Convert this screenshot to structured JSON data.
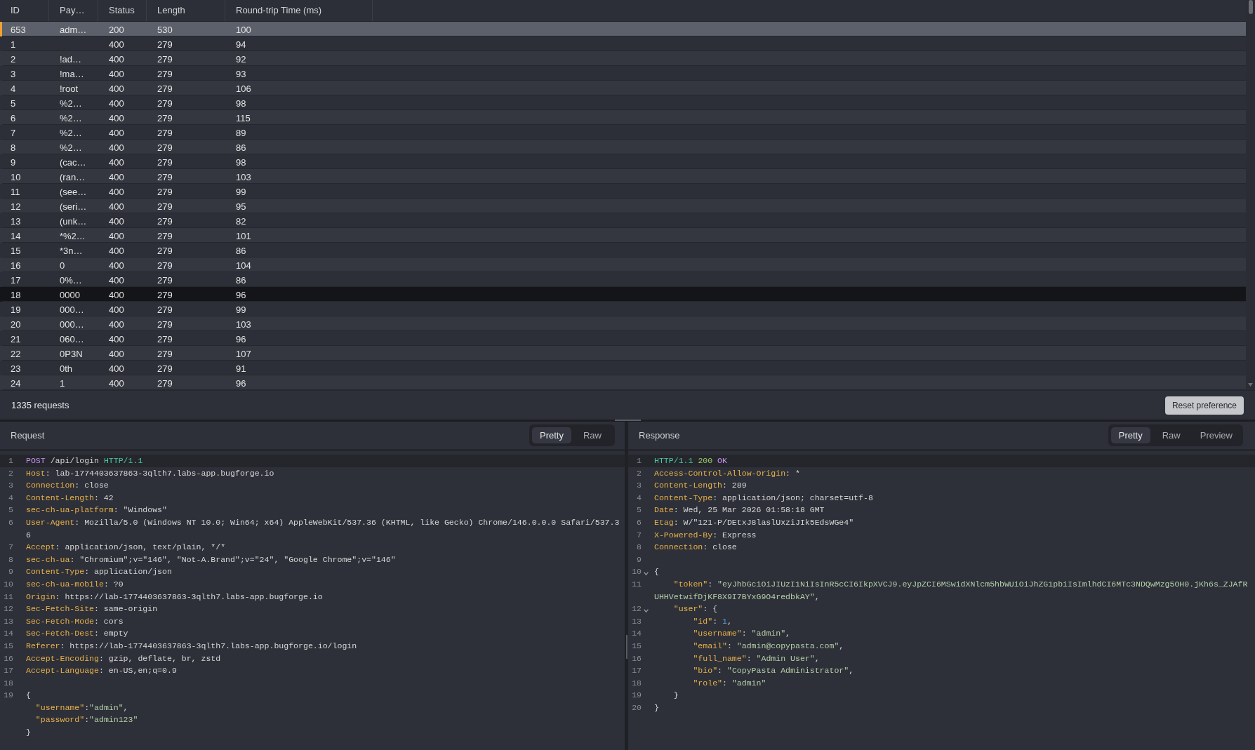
{
  "table": {
    "columns": [
      "ID",
      "Pay…",
      "Status",
      "Length",
      "Round-trip Time (ms)"
    ],
    "rows": [
      {
        "id": "653",
        "payload": "adm…",
        "status": "200",
        "length": "530",
        "round_trip_time": "100",
        "selected": true,
        "hovered": false
      },
      {
        "id": "1",
        "status": "400",
        "length": "279",
        "round_trip_time": "94",
        "selected": false,
        "hovered": false
      },
      {
        "id": "2",
        "payload": "!ad…",
        "status": "400",
        "length": "279",
        "round_trip_time": "92",
        "selected": false,
        "hovered": false
      },
      {
        "id": "3",
        "payload": "!ma…",
        "status": "400",
        "length": "279",
        "round_trip_time": "93",
        "selected": false,
        "hovered": false
      },
      {
        "id": "4",
        "payload": "!root",
        "status": "400",
        "length": "279",
        "round_trip_time": "106",
        "selected": false,
        "hovered": false
      },
      {
        "id": "5",
        "payload": "%2…",
        "status": "400",
        "length": "279",
        "round_trip_time": "98",
        "selected": false,
        "hovered": false
      },
      {
        "id": "6",
        "payload": "%2…",
        "status": "400",
        "length": "279",
        "round_trip_time": "115",
        "selected": false,
        "hovered": false
      },
      {
        "id": "7",
        "payload": "%2…",
        "status": "400",
        "length": "279",
        "round_trip_time": "89",
        "selected": false,
        "hovered": false
      },
      {
        "id": "8",
        "payload": "%2…",
        "status": "400",
        "length": "279",
        "round_trip_time": "86",
        "selected": false,
        "hovered": false
      },
      {
        "id": "9",
        "payload": "(cac…",
        "status": "400",
        "length": "279",
        "round_trip_time": "98",
        "selected": false,
        "hovered": false
      },
      {
        "id": "10",
        "payload": "(ran…",
        "status": "400",
        "length": "279",
        "round_trip_time": "103",
        "selected": false,
        "hovered": false
      },
      {
        "id": "11",
        "payload": "(see…",
        "status": "400",
        "length": "279",
        "round_trip_time": "99",
        "selected": false,
        "hovered": false
      },
      {
        "id": "12",
        "payload": "(seri…",
        "status": "400",
        "length": "279",
        "round_trip_time": "95",
        "selected": false,
        "hovered": false
      },
      {
        "id": "13",
        "payload": "(unk…",
        "status": "400",
        "length": "279",
        "round_trip_time": "82",
        "selected": false,
        "hovered": false
      },
      {
        "id": "14",
        "payload": "*%2…",
        "status": "400",
        "length": "279",
        "round_trip_time": "101",
        "selected": false,
        "hovered": false
      },
      {
        "id": "15",
        "payload": "*3n…",
        "status": "400",
        "length": "279",
        "round_trip_time": "86",
        "selected": false,
        "hovered": false
      },
      {
        "id": "16",
        "payload": "0",
        "status": "400",
        "length": "279",
        "round_trip_time": "104",
        "selected": false,
        "hovered": false
      },
      {
        "id": "17",
        "payload": "0%…",
        "status": "400",
        "length": "279",
        "round_trip_time": "86",
        "selected": false,
        "hovered": false
      },
      {
        "id": "18",
        "payload": "0000",
        "status": "400",
        "length": "279",
        "round_trip_time": "96",
        "selected": false,
        "hovered": true
      },
      {
        "id": "19",
        "payload": "000…",
        "status": "400",
        "length": "279",
        "round_trip_time": "99",
        "selected": false,
        "hovered": false
      },
      {
        "id": "20",
        "payload": "000…",
        "status": "400",
        "length": "279",
        "round_trip_time": "103",
        "selected": false,
        "hovered": false
      },
      {
        "id": "21",
        "payload": "060…",
        "status": "400",
        "length": "279",
        "round_trip_time": "96",
        "selected": false,
        "hovered": false
      },
      {
        "id": "22",
        "payload": "0P3N",
        "status": "400",
        "length": "279",
        "round_trip_time": "107",
        "selected": false,
        "hovered": false
      },
      {
        "id": "23",
        "payload": "0th",
        "status": "400",
        "length": "279",
        "round_trip_time": "91",
        "selected": false,
        "hovered": false
      },
      {
        "id": "24",
        "payload": "1",
        "status": "400",
        "length": "279",
        "round_trip_time": "96",
        "selected": false,
        "hovered": false
      }
    ]
  },
  "status_bar": {
    "request_count": "1335 requests",
    "reset_button": "Reset preference"
  },
  "request": {
    "title": "Request",
    "tabs": [
      {
        "label": "Pretty",
        "selected": true
      },
      {
        "label": "Raw",
        "selected": false
      }
    ],
    "lines": [
      {
        "number": "1",
        "active": true,
        "tokens": [
          {
            "kind": "method",
            "text": "POST"
          },
          {
            "kind": "plain",
            "text": " /api/login "
          },
          {
            "kind": "protocol",
            "text": "HTTP/1.1"
          }
        ]
      },
      {
        "number": "2",
        "active": false,
        "tokens": [
          {
            "kind": "key",
            "text": "Host"
          },
          {
            "kind": "plain",
            "text": ": lab-1774403637863-3qlth7.labs-app.bugforge.io"
          }
        ]
      },
      {
        "number": "3",
        "active": false,
        "tokens": [
          {
            "kind": "key",
            "text": "Connection"
          },
          {
            "kind": "plain",
            "text": ": close"
          }
        ]
      },
      {
        "number": "4",
        "active": false,
        "tokens": [
          {
            "kind": "key",
            "text": "Content-Length"
          },
          {
            "kind": "plain",
            "text": ": 42"
          }
        ]
      },
      {
        "number": "5",
        "active": false,
        "tokens": [
          {
            "kind": "key",
            "text": "sec-ch-ua-platform"
          },
          {
            "kind": "plain",
            "text": ": \"Windows\""
          }
        ]
      },
      {
        "number": "6",
        "active": false,
        "tokens": [
          {
            "kind": "key",
            "text": "User-Agent"
          },
          {
            "kind": "plain",
            "text": ": Mozilla/5.0 (Windows NT 10.0; Win64; x64) AppleWebKit/537.36 (KHTML, like Gecko) Chrome/146.0.0.0 Safari/537.36"
          }
        ]
      },
      {
        "number": "7",
        "active": false,
        "tokens": [
          {
            "kind": "key",
            "text": "Accept"
          },
          {
            "kind": "plain",
            "text": ": application/json, text/plain, */*"
          }
        ]
      },
      {
        "number": "8",
        "active": false,
        "tokens": [
          {
            "kind": "key",
            "text": "sec-ch-ua"
          },
          {
            "kind": "plain",
            "text": ": \"Chromium\";v=\"146\", \"Not-A.Brand\";v=\"24\", \"Google Chrome\";v=\"146\""
          }
        ]
      },
      {
        "number": "9",
        "active": false,
        "tokens": [
          {
            "kind": "key",
            "text": "Content-Type"
          },
          {
            "kind": "plain",
            "text": ": application/json"
          }
        ]
      },
      {
        "number": "10",
        "active": false,
        "tokens": [
          {
            "kind": "key",
            "text": "sec-ch-ua-mobile"
          },
          {
            "kind": "plain",
            "text": ": ?0"
          }
        ]
      },
      {
        "number": "11",
        "active": false,
        "tokens": [
          {
            "kind": "key",
            "text": "Origin"
          },
          {
            "kind": "plain",
            "text": ": https://lab-1774403637863-3qlth7.labs-app.bugforge.io"
          }
        ]
      },
      {
        "number": "12",
        "active": false,
        "tokens": [
          {
            "kind": "key",
            "text": "Sec-Fetch-Site"
          },
          {
            "kind": "plain",
            "text": ": same-origin"
          }
        ]
      },
      {
        "number": "13",
        "active": false,
        "tokens": [
          {
            "kind": "key",
            "text": "Sec-Fetch-Mode"
          },
          {
            "kind": "plain",
            "text": ": cors"
          }
        ]
      },
      {
        "number": "14",
        "active": false,
        "tokens": [
          {
            "kind": "key",
            "text": "Sec-Fetch-Dest"
          },
          {
            "kind": "plain",
            "text": ": empty"
          }
        ]
      },
      {
        "number": "15",
        "active": false,
        "tokens": [
          {
            "kind": "key",
            "text": "Referer"
          },
          {
            "kind": "plain",
            "text": ": https://lab-1774403637863-3qlth7.labs-app.bugforge.io/login"
          }
        ]
      },
      {
        "number": "16",
        "active": false,
        "tokens": [
          {
            "kind": "key",
            "text": "Accept-Encoding"
          },
          {
            "kind": "plain",
            "text": ": gzip, deflate, br, zstd"
          }
        ]
      },
      {
        "number": "17",
        "active": false,
        "tokens": [
          {
            "kind": "key",
            "text": "Accept-Language"
          },
          {
            "kind": "plain",
            "text": ": en-US,en;q=0.9"
          }
        ]
      },
      {
        "number": "18",
        "active": false
      },
      {
        "number": "19",
        "active": false,
        "tokens": [
          {
            "kind": "plain",
            "text": "{"
          }
        ]
      },
      {
        "active": false,
        "tokens": [
          {
            "kind": "key",
            "text": "  \"username\""
          },
          {
            "kind": "plain",
            "text": ":"
          },
          {
            "kind": "string",
            "text": "\"admin\""
          },
          {
            "kind": "plain",
            "text": ","
          }
        ]
      },
      {
        "active": false,
        "tokens": [
          {
            "kind": "key",
            "text": "  \"password\""
          },
          {
            "kind": "plain",
            "text": ":"
          },
          {
            "kind": "string",
            "text": "\"admin123\""
          }
        ]
      },
      {
        "active": false,
        "tokens": [
          {
            "kind": "plain",
            "text": "}"
          }
        ]
      }
    ]
  },
  "response": {
    "title": "Response",
    "tabs": [
      {
        "label": "Pretty",
        "selected": true
      },
      {
        "label": "Raw",
        "selected": false
      },
      {
        "label": "Preview",
        "selected": false
      }
    ],
    "lines": [
      {
        "number": "1",
        "active": true,
        "tokens": [
          {
            "kind": "protocol",
            "text": "HTTP/1.1 "
          },
          {
            "kind": "status",
            "text": "200 "
          },
          {
            "kind": "reason",
            "text": "OK"
          }
        ]
      },
      {
        "number": "2",
        "active": false,
        "tokens": [
          {
            "kind": "key",
            "text": "Access-Control-Allow-Origin"
          },
          {
            "kind": "plain",
            "text": ": *"
          }
        ]
      },
      {
        "number": "3",
        "active": false,
        "tokens": [
          {
            "kind": "key",
            "text": "Content-Length"
          },
          {
            "kind": "plain",
            "text": ": 289"
          }
        ]
      },
      {
        "number": "4",
        "active": false,
        "tokens": [
          {
            "kind": "key",
            "text": "Content-Type"
          },
          {
            "kind": "plain",
            "text": ": application/json; charset=utf-8"
          }
        ]
      },
      {
        "number": "5",
        "active": false,
        "tokens": [
          {
            "kind": "key",
            "text": "Date"
          },
          {
            "kind": "plain",
            "text": ": Wed, 25 Mar 2026 01:58:18 GMT"
          }
        ]
      },
      {
        "number": "6",
        "active": false,
        "tokens": [
          {
            "kind": "key",
            "text": "Etag"
          },
          {
            "kind": "plain",
            "text": ": W/\"121-P/DEtxJ8laslUxziJIk5EdsWGe4\""
          }
        ]
      },
      {
        "number": "7",
        "active": false,
        "tokens": [
          {
            "kind": "key",
            "text": "X-Powered-By"
          },
          {
            "kind": "plain",
            "text": ": Express"
          }
        ]
      },
      {
        "number": "8",
        "active": false,
        "tokens": [
          {
            "kind": "key",
            "text": "Connection"
          },
          {
            "kind": "plain",
            "text": ": close"
          }
        ]
      },
      {
        "number": "9",
        "active": false
      },
      {
        "number": "10",
        "active": false,
        "expanded": true,
        "tokens": [
          {
            "kind": "plain",
            "text": "{"
          }
        ]
      },
      {
        "number": "11",
        "active": false,
        "tokens": [
          {
            "kind": "key",
            "text": "    \"token\""
          },
          {
            "kind": "plain",
            "text": ": "
          },
          {
            "kind": "string",
            "text": "\"eyJhbGciOiJIUzI1NiIsInR5cCI6IkpXVCJ9.eyJpZCI6MSwidXNlcm5hbWUiOiJhZG1pbiIsImlhdCI6MTc3NDQwMzg5OH0.jKh6s_ZJAfRUHHVetwifDjKF8X9I7BYxG9O4redbkAY\""
          },
          {
            "kind": "plain",
            "text": ","
          }
        ]
      },
      {
        "number": "12",
        "active": false,
        "expanded": true,
        "tokens": [
          {
            "kind": "key",
            "text": "    \"user\""
          },
          {
            "kind": "plain",
            "text": ": {"
          }
        ]
      },
      {
        "number": "13",
        "active": false,
        "tokens": [
          {
            "kind": "key",
            "text": "        \"id\""
          },
          {
            "kind": "plain",
            "text": ": "
          },
          {
            "kind": "number",
            "text": "1"
          },
          {
            "kind": "plain",
            "text": ","
          }
        ]
      },
      {
        "number": "14",
        "active": false,
        "tokens": [
          {
            "kind": "key",
            "text": "        \"username\""
          },
          {
            "kind": "plain",
            "text": ": "
          },
          {
            "kind": "string",
            "text": "\"admin\""
          },
          {
            "kind": "plain",
            "text": ","
          }
        ]
      },
      {
        "number": "15",
        "active": false,
        "tokens": [
          {
            "kind": "key",
            "text": "        \"email\""
          },
          {
            "kind": "plain",
            "text": ": "
          },
          {
            "kind": "string",
            "text": "\"admin@copypasta.com\""
          },
          {
            "kind": "plain",
            "text": ","
          }
        ]
      },
      {
        "number": "16",
        "active": false,
        "tokens": [
          {
            "kind": "key",
            "text": "        \"full_name\""
          },
          {
            "kind": "plain",
            "text": ": "
          },
          {
            "kind": "string",
            "text": "\"Admin User\""
          },
          {
            "kind": "plain",
            "text": ","
          }
        ]
      },
      {
        "number": "17",
        "active": false,
        "tokens": [
          {
            "kind": "key",
            "text": "        \"bio\""
          },
          {
            "kind": "plain",
            "text": ": "
          },
          {
            "kind": "string",
            "text": "\"CopyPasta Administrator\""
          },
          {
            "kind": "plain",
            "text": ","
          }
        ]
      },
      {
        "number": "18",
        "active": false,
        "tokens": [
          {
            "kind": "key",
            "text": "        \"role\""
          },
          {
            "kind": "plain",
            "text": ": "
          },
          {
            "kind": "string",
            "text": "\"admin\""
          }
        ]
      },
      {
        "number": "19",
        "active": false,
        "tokens": [
          {
            "kind": "plain",
            "text": "    }"
          }
        ]
      },
      {
        "number": "20",
        "active": false,
        "tokens": [
          {
            "kind": "plain",
            "text": "}"
          }
        ]
      }
    ]
  }
}
